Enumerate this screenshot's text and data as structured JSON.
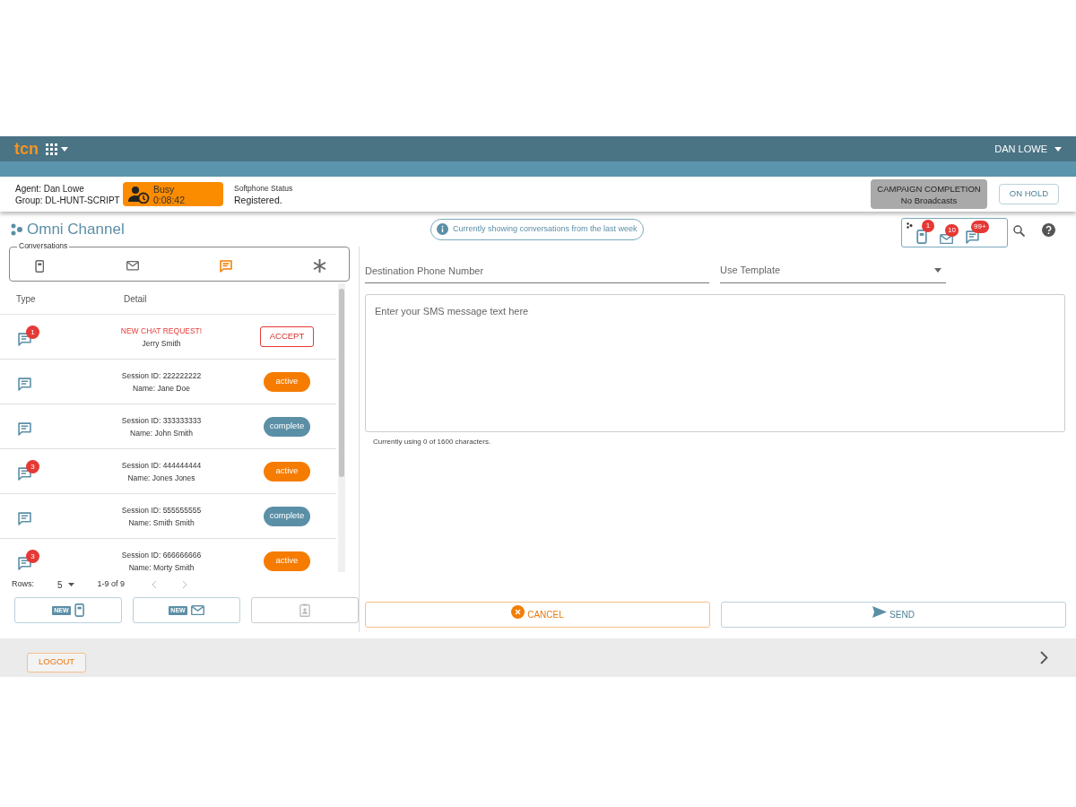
{
  "header": {
    "logo": "tcn",
    "user": "DAN LOWE"
  },
  "agent": {
    "agent": "Agent: Dan Lowe",
    "group": "Group: DL-HUNT-SCRIPT",
    "status": "Busy",
    "timer": "0:08:42",
    "softphone_label": "Softphone Status",
    "softphone_status": "Registered.",
    "campaign_title": "CAMPAIGN COMPLETION",
    "campaign_detail": "No Broadcasts",
    "hold_button": "ON HOLD"
  },
  "title": "Omni Channel",
  "info": "Currently showing conversations from the last week",
  "channel_counts": [
    {
      "kind": "phone",
      "count": "1"
    },
    {
      "kind": "mail",
      "count": "10"
    },
    {
      "kind": "chat",
      "count": "99+"
    }
  ],
  "conversations": {
    "legend": "Conversations",
    "tabs": [
      {
        "kind": "phone",
        "selected": false
      },
      {
        "kind": "mail",
        "selected": false
      },
      {
        "kind": "chat",
        "selected": true
      },
      {
        "kind": "asterisk",
        "selected": false
      }
    ]
  },
  "table": {
    "columns": [
      "Type",
      "Detail"
    ],
    "rows": [
      {
        "kind": "request",
        "unread": "1",
        "line1": "NEW CHAT REQUEST!",
        "line2": "Jerry Smith",
        "action": "ACCEPT"
      },
      {
        "kind": "session",
        "line1": "Session ID: 222222222",
        "line2": "Name: Jane Doe",
        "status": "active",
        "color": "#f57c00"
      },
      {
        "kind": "session",
        "line1": "Session ID: 333333333",
        "line2": "Name: John Smith",
        "status": "complete",
        "color": "#5b8fa6"
      },
      {
        "kind": "session",
        "unread": "3",
        "line1": "Session ID: 444444444",
        "line2": "Name: Jones Jones",
        "status": "active",
        "color": "#f57c00"
      },
      {
        "kind": "session",
        "line1": "Session ID: 555555555",
        "line2": "Name: Smith Smith",
        "status": "complete",
        "color": "#5b8fa6"
      },
      {
        "kind": "session",
        "unread": "3",
        "line1": "Session ID: 666666666",
        "line2": "Name: Morty Smith",
        "status": "active",
        "color": "#f57c00"
      }
    ]
  },
  "pagination": {
    "rows_label": "Rows:",
    "rows_value": "5",
    "range": "1-9 of 9"
  },
  "new_buttons": [
    {
      "kind": "phone",
      "badge": "NEW",
      "disabled": false
    },
    {
      "kind": "mail",
      "badge": "NEW",
      "disabled": false
    },
    {
      "kind": "contact",
      "disabled": true
    }
  ],
  "compose": {
    "phone_placeholder": "Destination Phone Number",
    "template_placeholder": "Use Template",
    "message_placeholder": "Enter your SMS message text here",
    "char_count": "Currently using 0 of 1600 characters.",
    "cancel": "CANCEL",
    "send": "SEND"
  },
  "footer": {
    "logout": "LOGOUT"
  }
}
